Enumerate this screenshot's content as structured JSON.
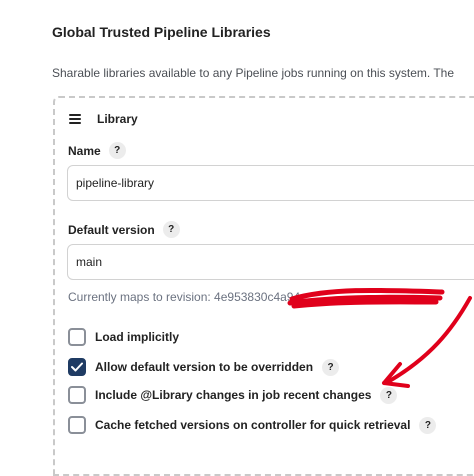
{
  "section": {
    "title": "Global Trusted Pipeline Libraries",
    "description": "Sharable libraries available to any Pipeline jobs running on this system. The"
  },
  "library": {
    "header": "Library",
    "help_glyph": "?",
    "name": {
      "label": "Name",
      "value": "pipeline-library"
    },
    "default_version": {
      "label": "Default version",
      "value": "main"
    },
    "revision_text": "Currently maps to revision: 4e953830c4a94",
    "checkboxes": [
      {
        "label": "Load implicitly",
        "checked": false
      },
      {
        "label": "Allow default version to be overridden",
        "checked": true
      },
      {
        "label": "Include @Library changes in job recent changes",
        "checked": false
      },
      {
        "label": "Cache fetched versions on controller for quick retrieval",
        "checked": false
      }
    ]
  },
  "colors": {
    "accent": "#1f3b63",
    "annotation": "#e0001b"
  },
  "icons": {
    "drag_handle": "hamburger-icon",
    "check": "check-icon",
    "help": "help-icon"
  }
}
